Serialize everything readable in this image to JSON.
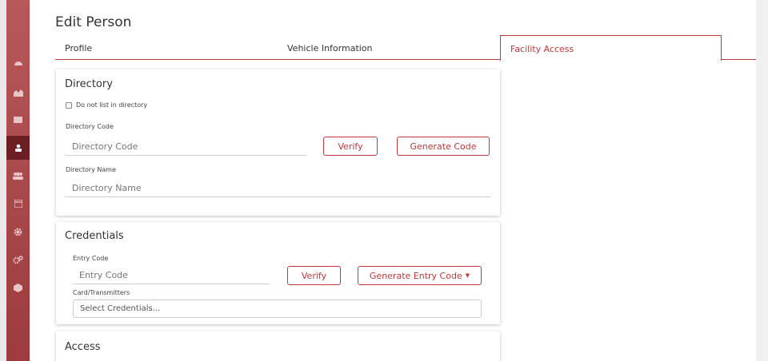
{
  "sidebar": {
    "icons": [
      "dashboard-icon",
      "chart-icon",
      "mail-icon",
      "person-icon",
      "group-icon",
      "calendar-icon",
      "gear-icon",
      "gears-icon",
      "box-icon"
    ],
    "active_index": 3
  },
  "page": {
    "title": "Edit Person"
  },
  "tabs": [
    {
      "label": "Profile"
    },
    {
      "label": "Vehicle Information"
    },
    {
      "label": "Facility Access"
    }
  ],
  "directory": {
    "title": "Directory",
    "checkbox_label": "Do not list in directory",
    "code_label": "Directory Code",
    "code_placeholder": "Directory Code",
    "verify_label": "Verify",
    "generate_label": "Generate Code",
    "name_label": "Directory Name",
    "name_placeholder": "Directory Name"
  },
  "credentials": {
    "title": "Credentials",
    "entry_label": "Entry Code",
    "entry_placeholder": "Entry Code",
    "verify_label": "Verify",
    "generate_label": "Generate Entry Code",
    "cards_label": "Card/Transmitters",
    "select_placeholder": "Select Credentials..."
  },
  "access": {
    "title": "Access"
  },
  "colors": {
    "accent": "#c0383b",
    "sidebar": "#a94347",
    "sidebar_active": "#6d1e23"
  }
}
